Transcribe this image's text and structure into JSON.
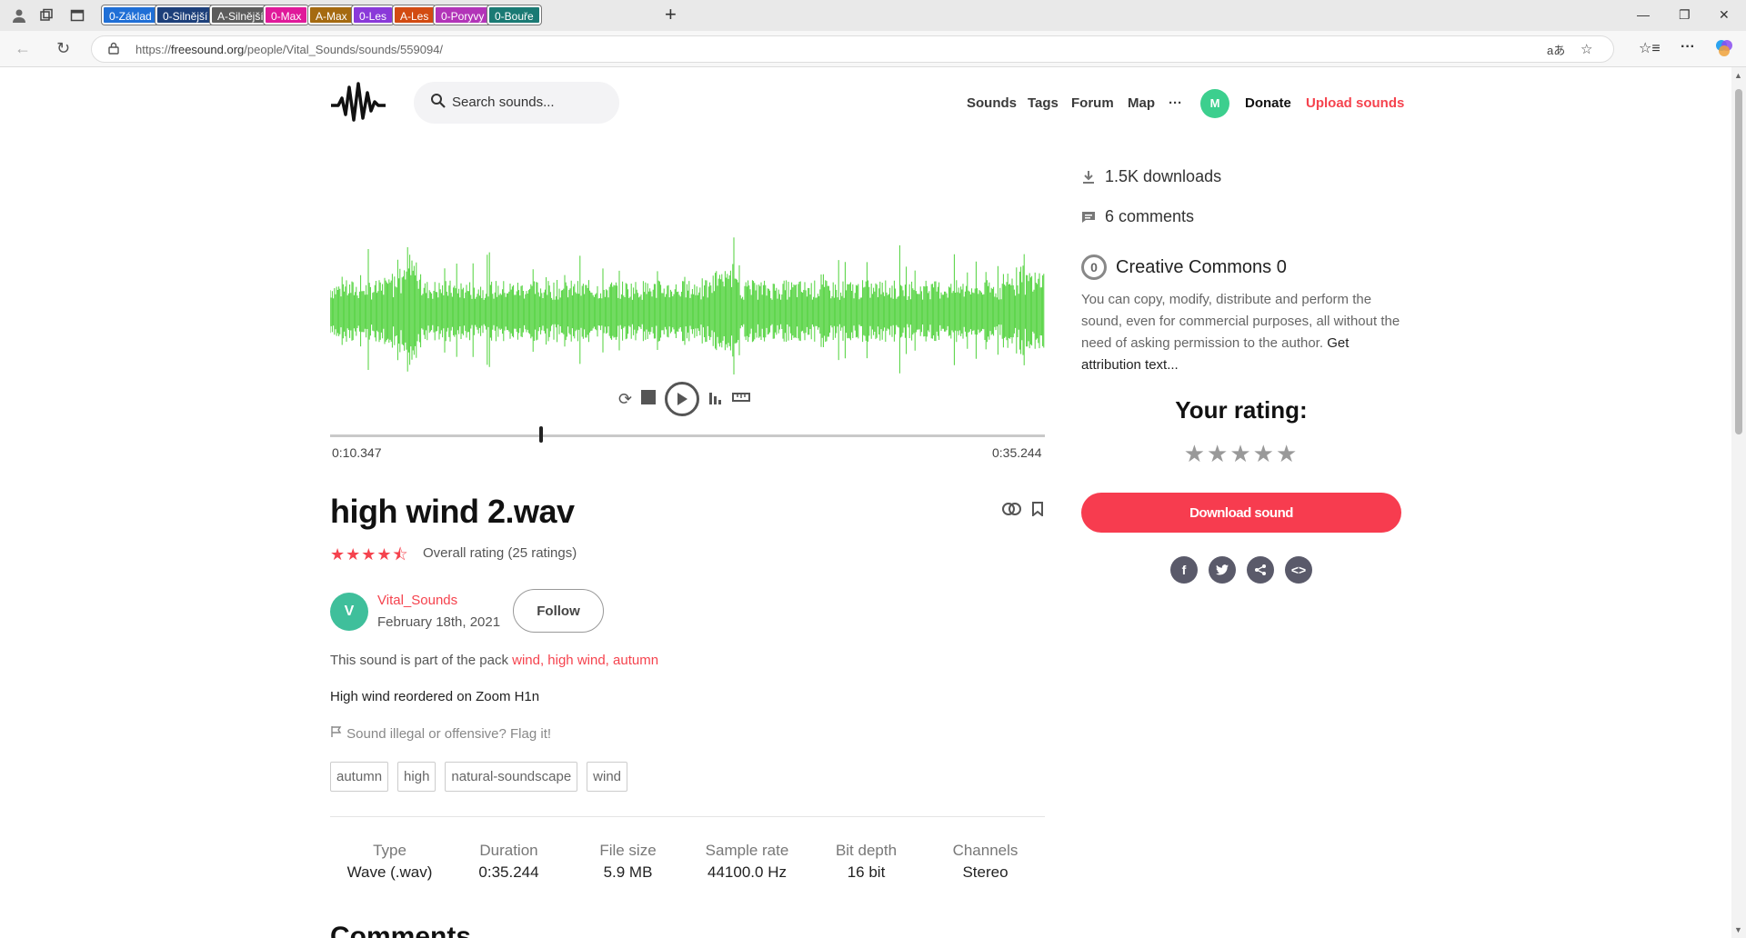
{
  "browser": {
    "tabs": [
      {
        "label": "0-Základ",
        "color": "#1f6fd6"
      },
      {
        "label": "0-Silnější",
        "color": "#1c3f7a"
      },
      {
        "label": "A-Silnější",
        "color": "#5c5c5c"
      },
      {
        "label": "0-Max",
        "color": "#e0199a"
      },
      {
        "label": "A-Max",
        "color": "#a56a10"
      },
      {
        "label": "0-Les",
        "color": "#8a39d9"
      },
      {
        "label": "A-Les",
        "color": "#d24b12"
      },
      {
        "label": "0-Poryvy",
        "color": "#b234b8"
      },
      {
        "label": "0-Bouře",
        "color": "#1a7a74"
      }
    ],
    "url_prefix": "https://",
    "url_host": "freesound.org",
    "url_path": "/people/Vital_Sounds/sounds/559094/"
  },
  "header": {
    "search_placeholder": "Search sounds...",
    "nav": [
      "Sounds",
      "Tags",
      "Forum",
      "Map",
      "···"
    ],
    "avatar_letter": "M",
    "donate": "Donate",
    "upload": "Upload sounds"
  },
  "player": {
    "progress_fraction": 0.295,
    "time_current": "0:10.347",
    "time_total": "0:35.244",
    "wave_color": "#4fd23a"
  },
  "sound": {
    "title": "high wind 2.wav",
    "stars": "★★★★⯪",
    "rating_text": "Overall rating (25 ratings)",
    "user_letter": "V",
    "username": "Vital_Sounds",
    "date": "February 18th, 2021",
    "follow": "Follow",
    "pack_prefix": "This sound is part of the pack ",
    "pack_name": "wind, high wind, autumn",
    "description": "High wind reordered on Zoom H1n",
    "flag": "Sound illegal or offensive? Flag it!",
    "tags": [
      "autumn",
      "high",
      "natural-soundscape",
      "wind"
    ],
    "meta": [
      {
        "label": "Type",
        "value": "Wave (.wav)"
      },
      {
        "label": "Duration",
        "value": "0:35.244"
      },
      {
        "label": "File size",
        "value": "5.9 MB"
      },
      {
        "label": "Sample rate",
        "value": "44100.0 Hz"
      },
      {
        "label": "Bit depth",
        "value": "16 bit"
      },
      {
        "label": "Channels",
        "value": "Stereo"
      }
    ],
    "comments_heading": "Comments"
  },
  "sidebar": {
    "downloads": "1.5K downloads",
    "comments": "6 comments",
    "license_icon": "0",
    "license_title": "Creative Commons 0",
    "license_desc": "You can copy, modify, distribute and perform the sound, even for commercial purposes, all without the need of asking permission to the author.",
    "attribution_link": "Get attribution text...",
    "your_rating": "Your rating:",
    "rating_stars": "★★★★★",
    "download_button": "Download sound",
    "share_icons": [
      "facebook-icon",
      "twitter-icon",
      "share-icon",
      "embed-icon"
    ]
  }
}
